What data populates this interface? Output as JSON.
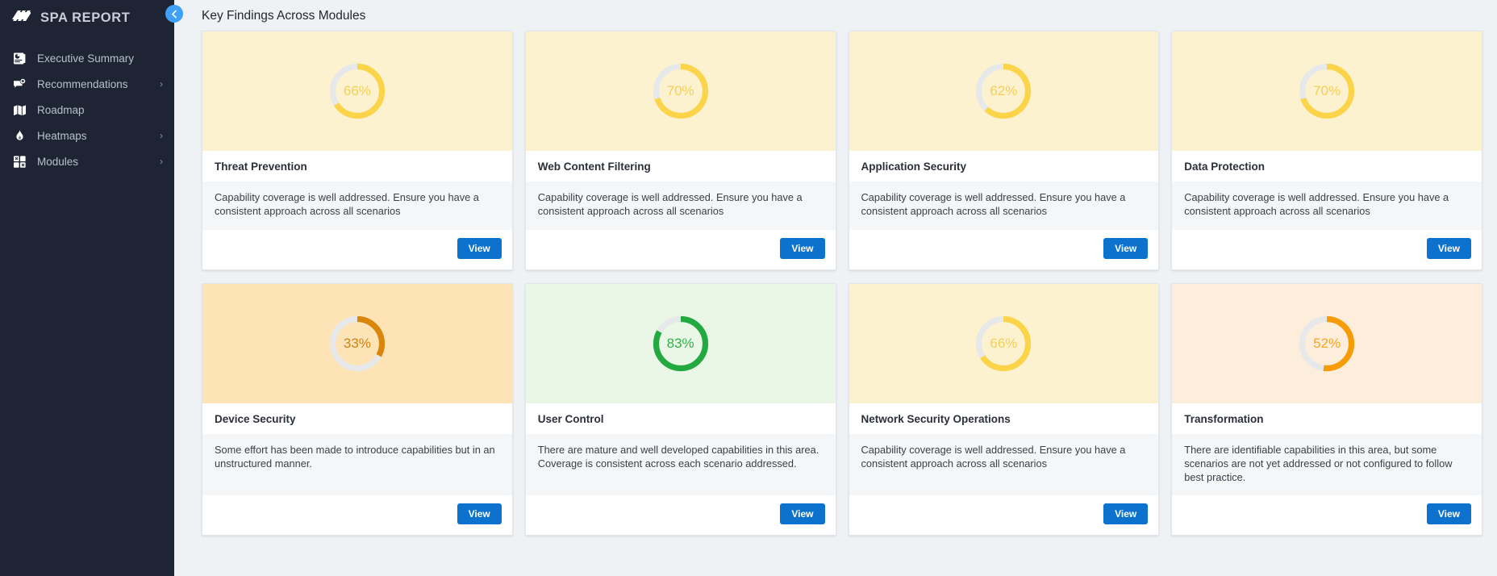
{
  "sidebar": {
    "brand": {
      "title": "SPA REPORT",
      "logo_icon": "slanted-bars-logo-icon"
    },
    "collapse_button": {
      "icon": "chevron-left-icon",
      "label": ""
    },
    "items": [
      {
        "label": "Executive Summary",
        "icon": "report-chart-icon",
        "has_caret": false,
        "caret": ""
      },
      {
        "label": "Recommendations",
        "icon": "recommendation-badge-icon",
        "has_caret": true,
        "caret": "›"
      },
      {
        "label": "Roadmap",
        "icon": "map-icon",
        "has_caret": false,
        "caret": ""
      },
      {
        "label": "Heatmaps",
        "icon": "flame-icon",
        "has_caret": true,
        "caret": "›"
      },
      {
        "label": "Modules",
        "icon": "puzzle-grid-icon",
        "has_caret": true,
        "caret": "›"
      }
    ]
  },
  "main": {
    "page_title": "Key Findings Across Modules",
    "view_label": "View"
  },
  "colors": {
    "accent_blue": "#0c72cd",
    "sidebar_bg": "#1e2433",
    "page_bg": "#eef2f5",
    "yellow": "#fbd44a",
    "orange": "#d9860a",
    "orange_bright": "#f59c07",
    "green": "#22a93f",
    "track_grey": "#e6e8ea"
  },
  "chart_data": {
    "type": "pie",
    "title": "Key Findings Across Modules",
    "subtitle": "",
    "xlabel": "",
    "ylabel": "",
    "legend_position": "none",
    "grid": false,
    "categories": [
      "Threat Prevention",
      "Web Content Filtering",
      "Application Security",
      "Data Protection",
      "Device Security",
      "User Control",
      "Network Security Operations",
      "Transformation"
    ],
    "values": [
      66,
      70,
      62,
      70,
      33,
      83,
      66,
      52
    ],
    "unit": "%",
    "series": [
      {
        "name": "Capability coverage",
        "values": [
          66,
          70,
          62,
          70,
          33,
          83,
          66,
          52
        ]
      }
    ]
  },
  "cards": [
    {
      "title": "Threat Prevention",
      "percent": 66,
      "percent_label": "66%",
      "description": "Capability coverage is well addressed. Ensure you have a consistent approach across all scenarios",
      "view_label": "View",
      "ring_color": "#fbd44a",
      "track_color": "#e6e8ea",
      "text_color": "#f5cf55",
      "banner_bg": "#fdf2cf"
    },
    {
      "title": "Web Content Filtering",
      "percent": 70,
      "percent_label": "70%",
      "description": "Capability coverage is well addressed. Ensure you have a consistent approach across all scenarios",
      "view_label": "View",
      "ring_color": "#fbd44a",
      "track_color": "#e6e8ea",
      "text_color": "#f5cf55",
      "banner_bg": "#fdf2cf"
    },
    {
      "title": "Application Security",
      "percent": 62,
      "percent_label": "62%",
      "description": "Capability coverage is well addressed. Ensure you have a consistent approach across all scenarios",
      "view_label": "View",
      "ring_color": "#fbd44a",
      "track_color": "#e6e8ea",
      "text_color": "#f5cf55",
      "banner_bg": "#fdf2cf"
    },
    {
      "title": "Data Protection",
      "percent": 70,
      "percent_label": "70%",
      "description": "Capability coverage is well addressed. Ensure you have a consistent approach across all scenarios",
      "view_label": "View",
      "ring_color": "#fbd44a",
      "track_color": "#e6e8ea",
      "text_color": "#f5cf55",
      "banner_bg": "#fdf2cf"
    },
    {
      "title": "Device Security",
      "percent": 33,
      "percent_label": "33%",
      "description": "Some effort has been made to introduce capabilities but in an unstructured manner.",
      "view_label": "View",
      "ring_color": "#d9860a",
      "track_color": "#e6e8ea",
      "text_color": "#cf8310",
      "banner_bg": "#fde3b6"
    },
    {
      "title": "User Control",
      "percent": 83,
      "percent_label": "83%",
      "description": "There are mature and well developed capabilities in this area. Coverage is consistent across each scenario addressed.",
      "view_label": "View",
      "ring_color": "#22a93f",
      "track_color": "#e6e8ea",
      "text_color": "#2fb14a",
      "banner_bg": "#eaf7e7"
    },
    {
      "title": "Network Security Operations",
      "percent": 66,
      "percent_label": "66%",
      "description": "Capability coverage is well addressed. Ensure you have a consistent approach across all scenarios",
      "view_label": "View",
      "ring_color": "#fbd44a",
      "track_color": "#e6e8ea",
      "text_color": "#f5cf55",
      "banner_bg": "#fdf2cf"
    },
    {
      "title": "Transformation",
      "percent": 52,
      "percent_label": "52%",
      "description": "There are identifiable capabilities in this area, but some scenarios are not yet addressed or not configured to follow best practice.",
      "view_label": "View",
      "ring_color": "#f59c07",
      "track_color": "#e6e8ea",
      "text_color": "#f5a623",
      "banner_bg": "#fdeedb"
    }
  ]
}
